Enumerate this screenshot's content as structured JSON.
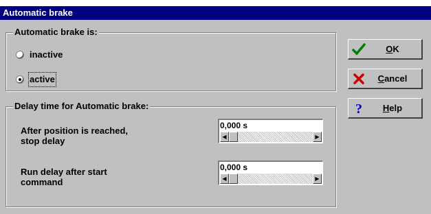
{
  "window": {
    "title": "Automatic brake"
  },
  "brake_group": {
    "title": "Automatic brake is:",
    "options": [
      {
        "label": "inactive",
        "selected": false
      },
      {
        "label": "active",
        "selected": true
      }
    ]
  },
  "delay_group": {
    "title": "Delay time for Automatic brake:",
    "stop_delay": {
      "label_line1": "After position is reached,",
      "label_line2": "stop delay",
      "value": "0,000 s"
    },
    "run_delay": {
      "label_line1": "Run delay after start",
      "label_line2": "command",
      "value": "0,000 s"
    }
  },
  "buttons": {
    "ok": {
      "label": "OK",
      "icon": "check-icon",
      "color": "#008000"
    },
    "cancel": {
      "label": "Cancel",
      "icon": "x-icon",
      "color": "#cc0000"
    },
    "help": {
      "label": "Help",
      "icon": "question-icon",
      "color": "#0000c0"
    }
  }
}
